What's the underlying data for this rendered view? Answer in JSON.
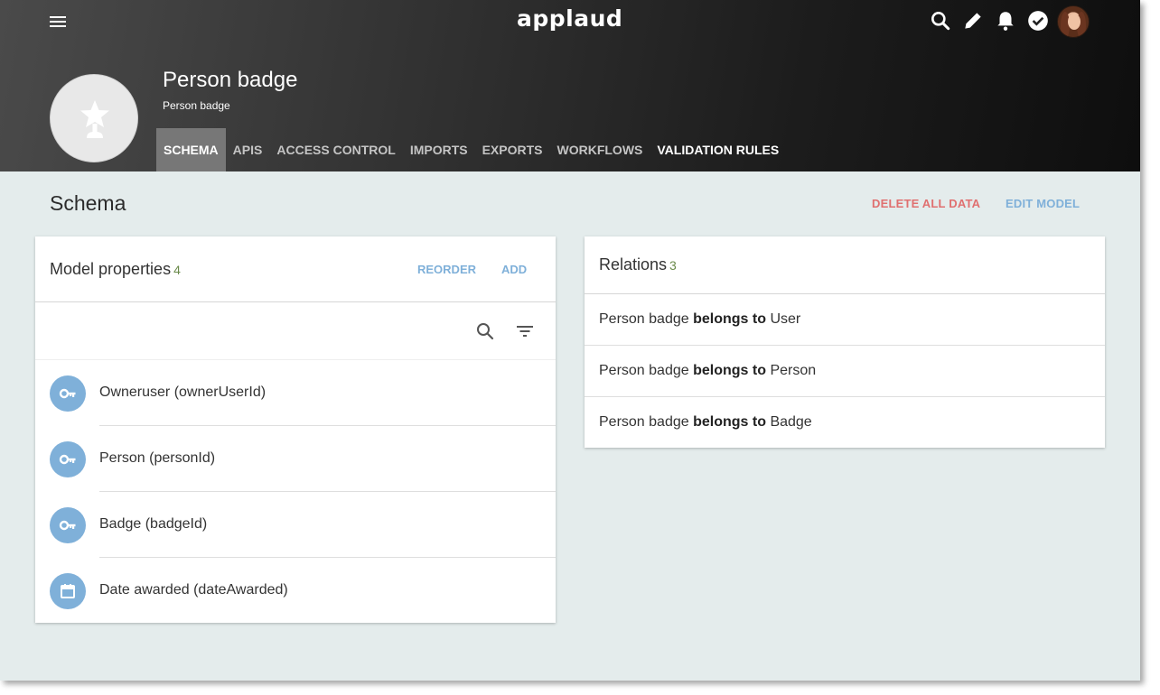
{
  "app": {
    "brand": "applaud"
  },
  "header": {
    "title": "Person badge",
    "subtitle": "Person badge",
    "icons": [
      "menu-icon",
      "search-icon",
      "pencil-icon",
      "bell-icon",
      "check-circle-icon",
      "user-avatar"
    ],
    "tabs": [
      {
        "label": "SCHEMA",
        "active": true
      },
      {
        "label": "APIS",
        "active": false
      },
      {
        "label": "ACCESS CONTROL",
        "active": false
      },
      {
        "label": "IMPORTS",
        "active": false
      },
      {
        "label": "EXPORTS",
        "active": false
      },
      {
        "label": "WORKFLOWS",
        "active": false
      },
      {
        "label": "VALIDATION RULES",
        "active": false
      }
    ]
  },
  "page": {
    "title": "Schema",
    "delete_label": "DELETE ALL DATA",
    "edit_label": "EDIT MODEL"
  },
  "properties": {
    "title": "Model properties",
    "count": "4",
    "reorder_label": "REORDER",
    "add_label": "ADD",
    "items": [
      {
        "label": "Owneruser (ownerUserId)",
        "icon": "key-icon"
      },
      {
        "label": "Person (personId)",
        "icon": "key-icon"
      },
      {
        "label": "Badge (badgeId)",
        "icon": "key-icon"
      },
      {
        "label": "Date awarded (dateAwarded)",
        "icon": "calendar-icon"
      }
    ]
  },
  "relations": {
    "title": "Relations",
    "count": "3",
    "items": [
      {
        "source": "Person badge",
        "verb": "belongs to",
        "target": "User"
      },
      {
        "source": "Person badge",
        "verb": "belongs to",
        "target": "Person"
      },
      {
        "source": "Person badge",
        "verb": "belongs to",
        "target": "Badge"
      }
    ]
  },
  "colors": {
    "accent_blue": "#7fb0d9",
    "danger_red": "#e07070",
    "background": "#e4ecec",
    "count_green": "#6a8a4a"
  }
}
